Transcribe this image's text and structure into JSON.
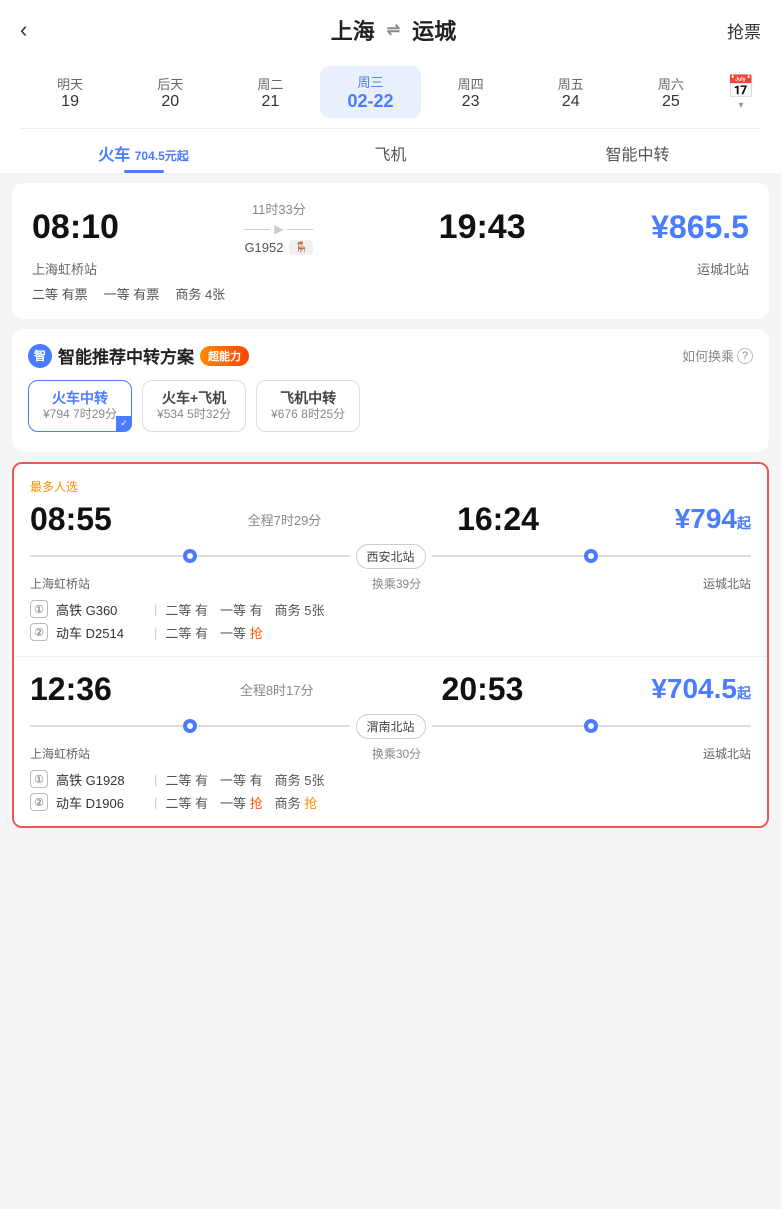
{
  "header": {
    "back_label": "‹",
    "origin": "上海",
    "destination": "运城",
    "swap_icon": "⇌",
    "grab_ticket": "抢票"
  },
  "date_tabs": [
    {
      "label": "明天",
      "date": "19",
      "active": false
    },
    {
      "label": "后天",
      "date": "20",
      "active": false
    },
    {
      "label": "周二",
      "date": "21",
      "active": false
    },
    {
      "label": "周三",
      "date": "02-22",
      "active": true
    },
    {
      "label": "周四",
      "date": "23",
      "active": false
    },
    {
      "label": "周五",
      "date": "24",
      "active": false
    },
    {
      "label": "周六",
      "date": "25",
      "active": false
    }
  ],
  "transport_tabs": [
    {
      "label": "火车",
      "sub": "704.5元起",
      "active": true
    },
    {
      "label": "飞机",
      "sub": "",
      "active": false
    },
    {
      "label": "智能中转",
      "sub": "",
      "active": false
    }
  ],
  "train_card": {
    "depart_time": "08:10",
    "depart_station": "上海虹桥站",
    "duration": "11时33分",
    "train_number": "G1952",
    "train_badge": "🪑",
    "arrive_time": "19:43",
    "arrive_station": "运城北站",
    "price": "¥865.5",
    "seats": [
      {
        "class": "二等",
        "status": "有票"
      },
      {
        "class": "一等",
        "status": "有票"
      },
      {
        "class": "商务",
        "status": "4张"
      }
    ]
  },
  "smart_section": {
    "title": "智能推荐中转方案",
    "badge": "超能力",
    "how_to": "如何换乘",
    "transfer_tabs": [
      {
        "main": "火车中转",
        "sub": "¥794 7时29分",
        "active": true
      },
      {
        "main": "火车+飞机",
        "sub": "¥534 5时32分",
        "active": false
      },
      {
        "main": "飞机中转",
        "sub": "¥676 8时25分",
        "active": false
      }
    ]
  },
  "result_items": [
    {
      "popular": "最多人选",
      "depart_time": "08:55",
      "duration": "全程7时29分",
      "arrive_time": "16:24",
      "price": "¥794",
      "price_from": "起",
      "depart_station": "上海虹桥站",
      "transfer_station": "西安北站",
      "transfer_wait": "换乘39分",
      "arrive_station": "运城北站",
      "legs": [
        {
          "num": "①",
          "train": "高铁 G360",
          "seats": [
            {
              "class": "二等",
              "status": "有",
              "highlight": false
            },
            {
              "class": "一等",
              "status": "有",
              "highlight": false
            },
            {
              "class": "商务",
              "status": "5张",
              "highlight": false
            }
          ]
        },
        {
          "num": "②",
          "train": "动车 D2514",
          "seats": [
            {
              "class": "二等",
              "status": "有",
              "highlight": false
            },
            {
              "class": "一等",
              "status": "抢",
              "highlight": true
            }
          ]
        }
      ]
    },
    {
      "popular": "",
      "depart_time": "12:36",
      "duration": "全程8时17分",
      "arrive_time": "20:53",
      "price": "¥704.5",
      "price_from": "起",
      "depart_station": "上海虹桥站",
      "transfer_station": "渭南北站",
      "transfer_wait": "换乘30分",
      "arrive_station": "运城北站",
      "legs": [
        {
          "num": "①",
          "train": "高铁 G1928",
          "seats": [
            {
              "class": "二等",
              "status": "有",
              "highlight": false
            },
            {
              "class": "一等",
              "status": "有",
              "highlight": false
            },
            {
              "class": "商务",
              "status": "5张",
              "highlight": false
            }
          ]
        },
        {
          "num": "②",
          "train": "动车 D1906",
          "seats": [
            {
              "class": "二等",
              "status": "有",
              "highlight": false
            },
            {
              "class": "一等",
              "status": "抢",
              "highlight": true
            },
            {
              "class": "商务",
              "status": "抢",
              "highlight": true,
              "is_orange": true
            }
          ]
        }
      ]
    }
  ],
  "colors": {
    "blue": "#4a7cff",
    "orange": "#ff8c00",
    "red_grab": "#ff5500",
    "border_red": "#e44"
  }
}
